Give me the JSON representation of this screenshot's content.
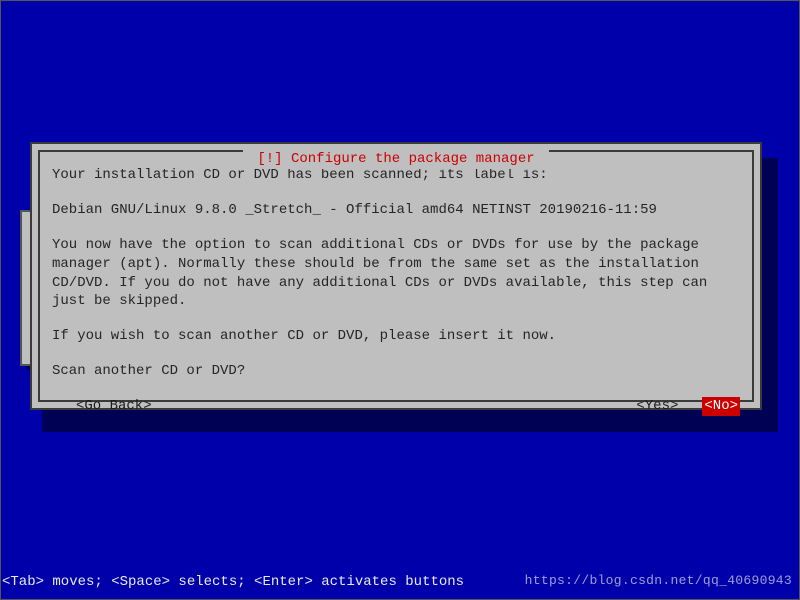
{
  "dialog": {
    "title": " [!] Configure the package manager ",
    "intro": "Your installation CD or DVD has been scanned; its label is:",
    "label": "Debian GNU/Linux 9.8.0 _Stretch_ - Official amd64 NETINST 20190216-11:59",
    "option_text": "You now have the option to scan additional CDs or DVDs for use by the package manager (apt). Normally these should be from the same set as the installation CD/DVD. If you do not have any additional CDs or DVDs available, this step can just be skipped.",
    "insert_text": "If you wish to scan another CD or DVD, please insert it now.",
    "question": "Scan another CD or DVD?",
    "buttons": {
      "go_back": "<Go Back>",
      "yes": "<Yes>",
      "no": "<No>"
    }
  },
  "status_bar": "<Tab> moves; <Space> selects; <Enter> activates buttons",
  "watermark": "https://blog.csdn.net/qq_40690943"
}
